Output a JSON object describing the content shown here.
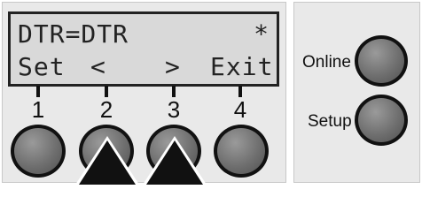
{
  "display": {
    "line1": "DTR=DTR",
    "flag": "*",
    "softkeys": [
      "Set",
      "<",
      ">",
      "Exit"
    ]
  },
  "keys": [
    "1",
    "2",
    "3",
    "4"
  ],
  "side_buttons": {
    "online": "Online",
    "setup": "Setup"
  },
  "highlighted_keys": [
    "2",
    "3"
  ],
  "icons": {
    "press_indicator": "up-arrow-icon"
  },
  "colors": {
    "panel": "#e9e9e9",
    "lcd": "#d9d9d9",
    "button": "#6f6f6f",
    "ink": "#111111"
  }
}
